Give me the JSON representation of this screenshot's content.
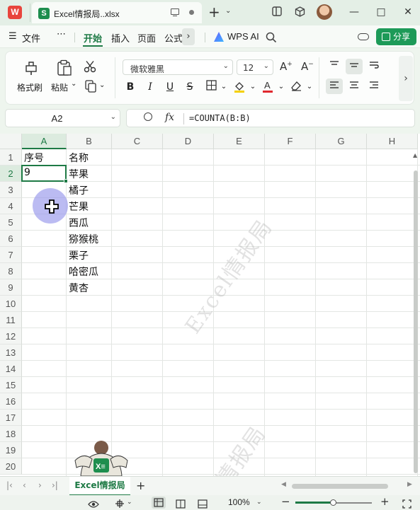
{
  "titlebar": {
    "app_logo": "W",
    "doc_icon_letter": "S",
    "doc_title": "Excel情报局..xlsx",
    "plus": "+",
    "chevron": "⌄",
    "icons": [
      "monitor-icon",
      "dot-icon",
      "layout-icon",
      "cube-icon",
      "avatar"
    ],
    "window_buttons": [
      "—",
      "□",
      "✕"
    ]
  },
  "menubar": {
    "hamburger": "☰",
    "file": "文件",
    "more": "⋯",
    "tabs": [
      "开始",
      "插入",
      "页面",
      "公式"
    ],
    "active_tab": "开始",
    "next": "›",
    "wps_ai": "WPS AI",
    "share": "分享"
  },
  "ribbon": {
    "format_painter": "格式刷",
    "paste": "粘贴",
    "font_name": "微软雅黑",
    "font_size": "12",
    "bold": "B",
    "italic": "I",
    "underline": "U",
    "strikethrough": "S",
    "chevron": "⌄",
    "next": "›"
  },
  "formulabar": {
    "namebox": "A2",
    "fx": "fx",
    "formula": "=COUNTA(B:B)"
  },
  "sheet": {
    "columns": [
      "A",
      "B",
      "C",
      "D",
      "E",
      "F",
      "G",
      "H"
    ],
    "selected_column": "A",
    "rows": [
      "1",
      "2",
      "3",
      "4",
      "5",
      "6",
      "7",
      "8",
      "9",
      "10",
      "11",
      "12",
      "13",
      "14",
      "15",
      "16",
      "17",
      "18",
      "19",
      "20"
    ],
    "selected_row": "2",
    "cells": {
      "A1": "序号",
      "B1": "名称",
      "A2": "9",
      "B2": "苹果",
      "B3": "橘子",
      "B4": "芒果",
      "B5": "西瓜",
      "B6": "猕猴桃",
      "B7": "栗子",
      "B8": "哈密瓜",
      "B9": "黄杏"
    },
    "watermark": "Excel情报局",
    "watermark_partial": "情报局",
    "mascot_badge": "X≡"
  },
  "sheetbar": {
    "nav": [
      "|‹",
      "‹",
      "›",
      "›|"
    ],
    "sheet_name": "Excel情报局",
    "add": "+"
  },
  "statusbar": {
    "zoom": "100%",
    "minus": "−",
    "plus": "+",
    "zoom_level": 0.5
  },
  "colors": {
    "accent": "#1e7a45",
    "share_button": "#1d9a58",
    "font_color": "#e0282e",
    "fill_color": "#f5d000"
  }
}
